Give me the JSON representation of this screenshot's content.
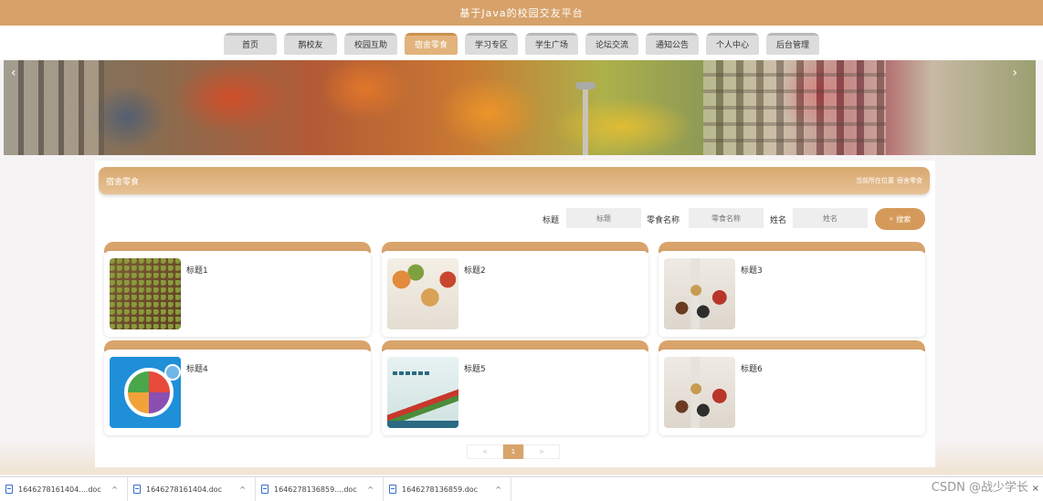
{
  "header": {
    "title": "基于Java的校园交友平台"
  },
  "nav": {
    "items": [
      {
        "label": "首页",
        "active": false
      },
      {
        "label": "鹊校友",
        "active": false
      },
      {
        "label": "校园互助",
        "active": false
      },
      {
        "label": "宿舍零食",
        "active": true
      },
      {
        "label": "学习专区",
        "active": false
      },
      {
        "label": "学生广场",
        "active": false
      },
      {
        "label": "论坛交流",
        "active": false
      },
      {
        "label": "通知公告",
        "active": false
      },
      {
        "label": "个人中心",
        "active": false
      },
      {
        "label": "后台管理",
        "active": false
      }
    ]
  },
  "banner": {
    "prev_icon": "‹",
    "next_icon": "›"
  },
  "section": {
    "title": "宿舍零食",
    "breadcrumb": [
      "当前所在位置",
      "宿舍零食"
    ]
  },
  "search": {
    "title_label": "标题",
    "title_placeholder": "标题",
    "snack_label": "零食名称",
    "snack_placeholder": "零食名称",
    "name_label": "姓名",
    "name_placeholder": "姓名",
    "button_label": "搜索"
  },
  "cards": [
    {
      "title": "标题1",
      "image": "green-beans-photo"
    },
    {
      "title": "标题2",
      "image": "snack-bowls-photo"
    },
    {
      "title": "标题3",
      "image": "spice-jars-photo"
    },
    {
      "title": "标题4",
      "image": "food-plate-diagram"
    },
    {
      "title": "标题5",
      "image": "nutrition-poster"
    },
    {
      "title": "标题6",
      "image": "spice-jars-photo"
    }
  ],
  "pagination": {
    "prev": "<",
    "current": "1",
    "next": ">"
  },
  "downloads": [
    {
      "name": "1646278161404....doc"
    },
    {
      "name": "1646278161404.doc"
    },
    {
      "name": "1646278136859....doc"
    },
    {
      "name": "1646278136859.doc"
    }
  ],
  "watermark": "CSDN @战少学长",
  "colors": {
    "accent": "#d7a26a",
    "active_tab": "#e2b37c",
    "nav_tab": "#dcdcdc"
  }
}
